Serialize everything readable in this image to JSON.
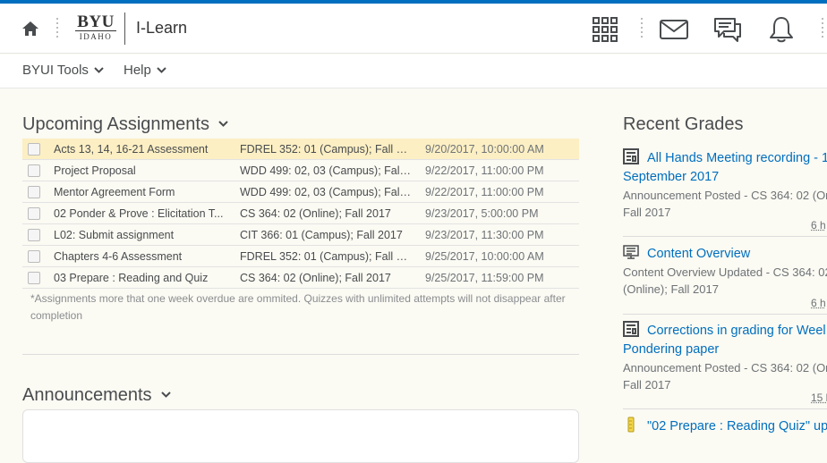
{
  "header": {
    "logo_top": "BYU",
    "logo_bottom": "IDAHO",
    "app_title": "I-Learn"
  },
  "nav": {
    "items": [
      {
        "label": "BYUI Tools"
      },
      {
        "label": "Help"
      }
    ]
  },
  "upcoming": {
    "title": "Upcoming Assignments",
    "rows": [
      {
        "name": "Acts 13, 14, 16-21 Assessment",
        "course": "FDREL 352: 01 (Campus); Fall 20...",
        "due": "9/20/2017, 10:00:00 AM"
      },
      {
        "name": "Project Proposal",
        "course": "WDD 499: 02, 03 (Campus); Fall ...",
        "due": "9/22/2017, 11:00:00 PM"
      },
      {
        "name": "Mentor Agreement Form",
        "course": "WDD 499: 02, 03 (Campus); Fall ...",
        "due": "9/22/2017, 11:00:00 PM"
      },
      {
        "name": "02 Ponder & Prove : Elicitation T...",
        "course": "CS 364: 02 (Online); Fall 2017",
        "due": "9/23/2017, 5:00:00 PM"
      },
      {
        "name": "L02: Submit assignment",
        "course": "CIT 366: 01 (Campus); Fall 2017",
        "due": "9/23/2017, 11:30:00 PM"
      },
      {
        "name": "Chapters 4-6 Assessment",
        "course": "FDREL 352: 01 (Campus); Fall 20...",
        "due": "9/25/2017, 10:00:00 AM"
      },
      {
        "name": "03 Prepare : Reading and Quiz",
        "course": "CS 364: 02 (Online); Fall 2017",
        "due": "9/25/2017, 11:59:00 PM"
      }
    ],
    "note": "*Assignments more that one week overdue are ommited. Quizzes with unlimited attempts will not disappear after completion"
  },
  "announcements": {
    "title": "Announcements"
  },
  "recent_grades": {
    "title": "Recent Grades",
    "items": [
      {
        "link1": "All Hands Meeting recording - 1",
        "link2": "September 2017",
        "sub1": "Announcement Posted - CS 364: 02 (On",
        "sub2": "Fall 2017",
        "time": "6 h",
        "icon": "announcement-icon"
      },
      {
        "link1": "Content Overview",
        "link2": "",
        "sub1": "Content Overview Updated - CS 364: 02",
        "sub2": "(Online); Fall 2017",
        "time": "6 h",
        "icon": "content-icon"
      },
      {
        "link1": "Corrections in grading for Weel",
        "link2": "Pondering paper",
        "sub1": "Announcement Posted - CS 364: 02 (On",
        "sub2": "Fall 2017",
        "time": "15 h",
        "icon": "announcement-icon"
      },
      {
        "link1": "\"02 Prepare : Reading Quiz\" upc",
        "link2": "",
        "sub1": "",
        "sub2": "",
        "time": "",
        "icon": "quiz-icon"
      }
    ]
  },
  "colors": {
    "accent": "#006fbf",
    "highlight_row": "#fcefc4",
    "background": "#fbfaf3"
  }
}
